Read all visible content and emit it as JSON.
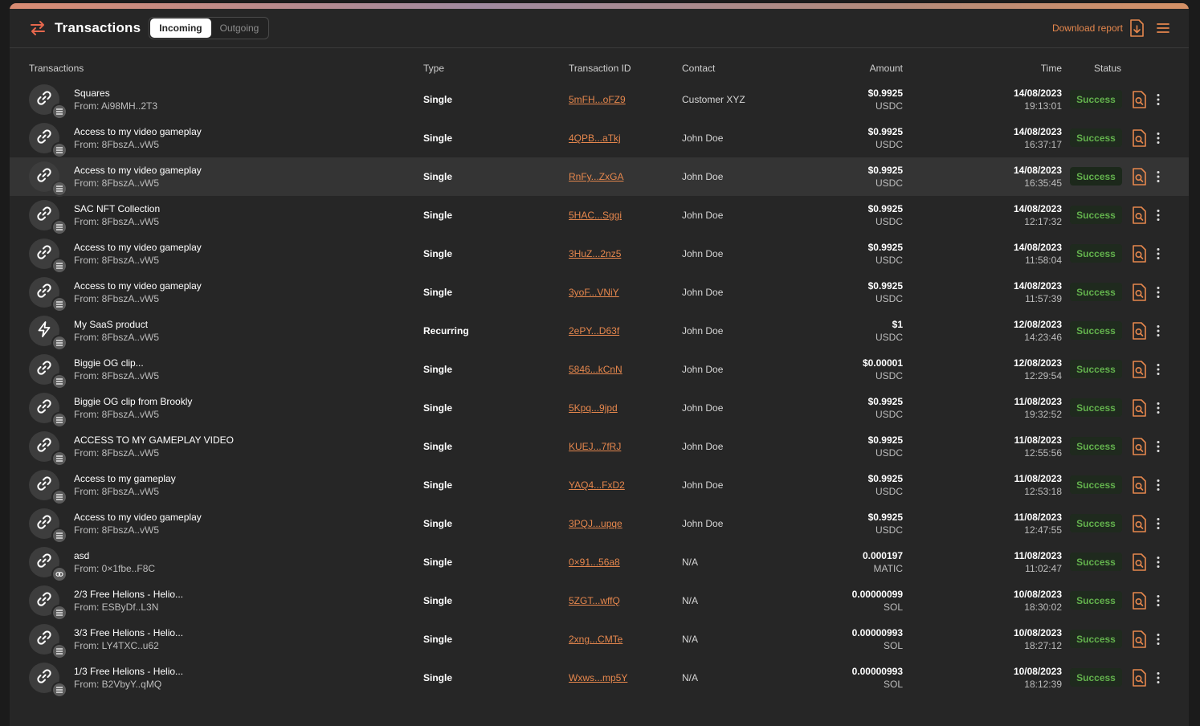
{
  "header": {
    "title": "Transactions",
    "tabs": [
      {
        "label": "Incoming",
        "active": true
      },
      {
        "label": "Outgoing",
        "active": false
      }
    ],
    "download_label": "Download report",
    "icons": {
      "logo": "transfer-arrows-icon",
      "download": "download-file-icon",
      "menu": "hamburger-menu-icon"
    }
  },
  "colors": {
    "accent": "#e6874d",
    "success": "#63b24d",
    "background": "#262626"
  },
  "columns": {
    "transactions": "Transactions",
    "type": "Type",
    "txid": "Transaction ID",
    "contact": "Contact",
    "amount": "Amount",
    "time": "Time",
    "status": "Status"
  },
  "rows": [
    {
      "name": "Squares",
      "from": "From: Ai98MH..2T3",
      "type": "Single",
      "txid": "5mFH...oFZ9",
      "contact": "Customer XYZ",
      "amount": "$0.9925",
      "currency": "USDC",
      "date": "14/08/2023",
      "time": "19:13:01",
      "status": "Success",
      "icon": "link-icon",
      "badge": "token-icon"
    },
    {
      "name": "Access to my video gameplay",
      "from": "From: 8FbszA..vW5",
      "type": "Single",
      "txid": "4QPB...aTkj",
      "contact": "John Doe",
      "amount": "$0.9925",
      "currency": "USDC",
      "date": "14/08/2023",
      "time": "16:37:17",
      "status": "Success",
      "icon": "link-icon",
      "badge": "token-icon"
    },
    {
      "name": "Access to my video gameplay",
      "from": "From: 8FbszA..vW5",
      "type": "Single",
      "txid": "RnFy...ZxGA",
      "contact": "John Doe",
      "amount": "$0.9925",
      "currency": "USDC",
      "date": "14/08/2023",
      "time": "16:35:45",
      "status": "Success",
      "icon": "link-icon",
      "badge": "token-icon",
      "highlighted": true
    },
    {
      "name": "SAC NFT Collection",
      "from": "From: 8FbszA..vW5",
      "type": "Single",
      "txid": "5HAC...Sggi",
      "contact": "John Doe",
      "amount": "$0.9925",
      "currency": "USDC",
      "date": "14/08/2023",
      "time": "12:17:32",
      "status": "Success",
      "icon": "link-icon",
      "badge": "token-icon"
    },
    {
      "name": "Access to my video gameplay",
      "from": "From: 8FbszA..vW5",
      "type": "Single",
      "txid": "3HuZ...2nz5",
      "contact": "John Doe",
      "amount": "$0.9925",
      "currency": "USDC",
      "date": "14/08/2023",
      "time": "11:58:04",
      "status": "Success",
      "icon": "link-icon",
      "badge": "token-icon"
    },
    {
      "name": "Access to my video gameplay",
      "from": "From: 8FbszA..vW5",
      "type": "Single",
      "txid": "3yoF...VNiY",
      "contact": "John Doe",
      "amount": "$0.9925",
      "currency": "USDC",
      "date": "14/08/2023",
      "time": "11:57:39",
      "status": "Success",
      "icon": "link-icon",
      "badge": "token-icon"
    },
    {
      "name": "My SaaS product",
      "from": "From: 8FbszA..vW5",
      "type": "Recurring",
      "txid": "2ePY...D63f",
      "contact": "John Doe",
      "amount": "$1",
      "currency": "USDC",
      "date": "12/08/2023",
      "time": "14:23:46",
      "status": "Success",
      "icon": "lightning-icon",
      "badge": "token-icon"
    },
    {
      "name": "Biggie OG clip...",
      "from": "From: 8FbszA..vW5",
      "type": "Single",
      "txid": "5846...kCnN",
      "contact": "John Doe",
      "amount": "$0.00001",
      "currency": "USDC",
      "date": "12/08/2023",
      "time": "12:29:54",
      "status": "Success",
      "icon": "link-icon",
      "badge": "token-icon"
    },
    {
      "name": "Biggie OG clip from Brookly",
      "from": "From: 8FbszA..vW5",
      "type": "Single",
      "txid": "5Kpq...9jpd",
      "contact": "John Doe",
      "amount": "$0.9925",
      "currency": "USDC",
      "date": "11/08/2023",
      "time": "19:32:52",
      "status": "Success",
      "icon": "link-icon",
      "badge": "token-icon"
    },
    {
      "name": "ACCESS TO MY GAMEPLAY VIDEO",
      "from": "From: 8FbszA..vW5",
      "type": "Single",
      "txid": "KUEJ...7fRJ",
      "contact": "John Doe",
      "amount": "$0.9925",
      "currency": "USDC",
      "date": "11/08/2023",
      "time": "12:55:56",
      "status": "Success",
      "icon": "link-icon",
      "badge": "token-icon"
    },
    {
      "name": "Access to my gameplay",
      "from": "From: 8FbszA..vW5",
      "type": "Single",
      "txid": "YAQ4...FxD2",
      "contact": "John Doe",
      "amount": "$0.9925",
      "currency": "USDC",
      "date": "11/08/2023",
      "time": "12:53:18",
      "status": "Success",
      "icon": "link-icon",
      "badge": "token-icon"
    },
    {
      "name": "Access to my video gameplay",
      "from": "From: 8FbszA..vW5",
      "type": "Single",
      "txid": "3PQJ...upqe",
      "contact": "John Doe",
      "amount": "$0.9925",
      "currency": "USDC",
      "date": "11/08/2023",
      "time": "12:47:55",
      "status": "Success",
      "icon": "link-icon",
      "badge": "token-icon"
    },
    {
      "name": "asd",
      "from": "From: 0×1fbe..F8C",
      "type": "Single",
      "txid": "0×91...56a8",
      "contact": "N/A",
      "amount": "0.000197",
      "currency": "MATIC",
      "date": "11/08/2023",
      "time": "11:02:47",
      "status": "Success",
      "icon": "link-icon",
      "badge": "polygon-icon"
    },
    {
      "name": "2/3 Free Helions - Helio...",
      "from": "From: ESByDf..L3N",
      "type": "Single",
      "txid": "5ZGT...wffQ",
      "contact": "N/A",
      "amount": "0.00000099",
      "currency": "SOL",
      "date": "10/08/2023",
      "time": "18:30:02",
      "status": "Success",
      "icon": "link-icon",
      "badge": "token-icon"
    },
    {
      "name": "3/3 Free Helions - Helio...",
      "from": "From: LY4TXC..u62",
      "type": "Single",
      "txid": "2xng...CMTe",
      "contact": "N/A",
      "amount": "0.00000993",
      "currency": "SOL",
      "date": "10/08/2023",
      "time": "18:27:12",
      "status": "Success",
      "icon": "link-icon",
      "badge": "token-icon"
    },
    {
      "name": "1/3 Free Helions - Helio...",
      "from": "From: B2VbyY..qMQ",
      "type": "Single",
      "txid": "Wxws...mp5Y",
      "contact": "N/A",
      "amount": "0.00000993",
      "currency": "SOL",
      "date": "10/08/2023",
      "time": "18:12:39",
      "status": "Success",
      "icon": "link-icon",
      "badge": "token-icon"
    }
  ]
}
